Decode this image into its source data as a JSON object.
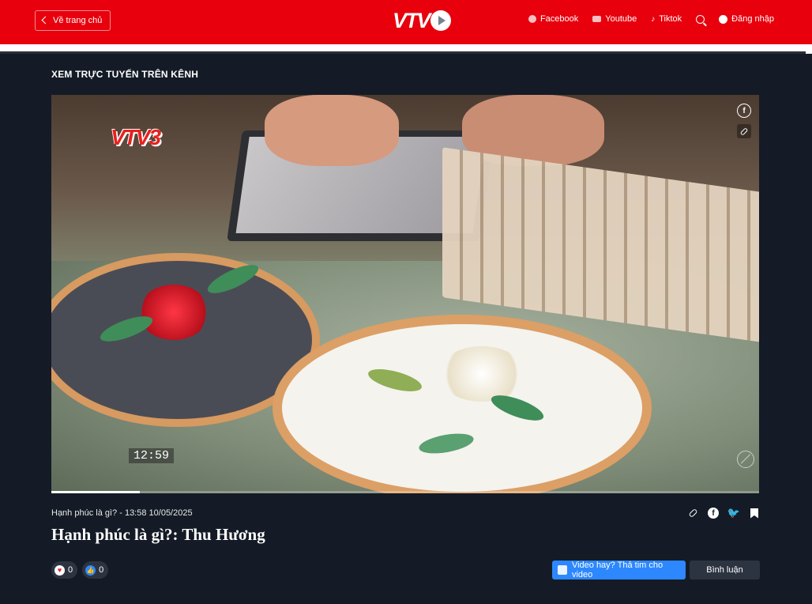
{
  "header": {
    "back_label": "Về trang chủ",
    "logo_text": "VTV",
    "nav": [
      {
        "label": "Facebook",
        "icon": "facebook-icon"
      },
      {
        "label": "Youtube",
        "icon": "youtube-icon"
      },
      {
        "label": "Tiktok",
        "icon": "tiktok-icon"
      }
    ],
    "login_label": "Đăng nhập",
    "accent_color": "#e8000d"
  },
  "section_title": "XEM TRỰC TUYẾN TRÊN KÊNH",
  "video": {
    "channel_logo": "VTV3",
    "timestamp_overlay": "12:59",
    "progress": 0.125
  },
  "info": {
    "meta": "Hạnh phúc là gì? - 13:58 10/05/2025",
    "title": "Hạnh phúc là gì?: Thu Hương",
    "reactions": [
      {
        "icon": "heart-icon",
        "count": "0"
      },
      {
        "icon": "like-icon",
        "count": "0"
      }
    ],
    "cta_label": "Video hay? Thả tim cho video",
    "comment_label": "Bình luận"
  }
}
